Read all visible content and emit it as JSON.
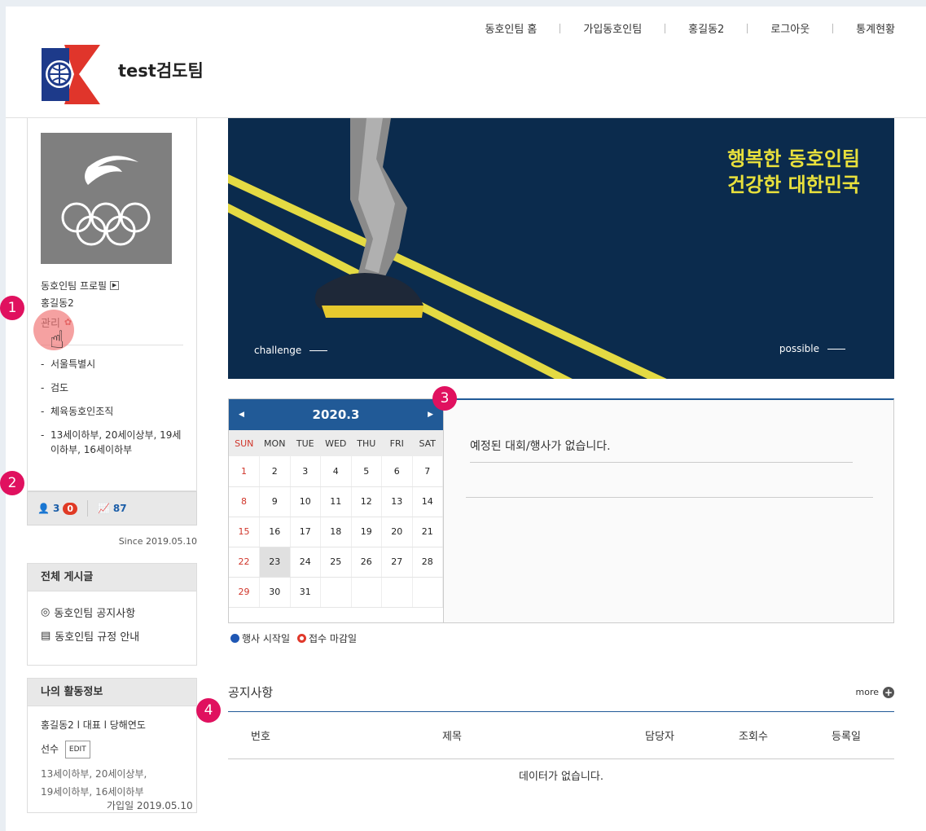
{
  "header": {
    "team_name": "test검도팀",
    "nav": [
      "동호인팀 홈",
      "가입동호인팀",
      "홍길동2",
      "로그아웃",
      "통계현황"
    ]
  },
  "sidebar": {
    "profile_link": "동호인팀 프로필",
    "user": "홍길동2",
    "manage": "관리",
    "info": [
      "서울특별시",
      "검도",
      "체육동호인조직",
      "13세이하부, 20세이상부, 19세이하부, 16세이하부"
    ],
    "members": "3",
    "pending": "0",
    "visits": "87",
    "since": "Since 2019.05.10",
    "board": {
      "title": "전체 게시글",
      "items": [
        "동호인팀 공지사항",
        "동호인팀 규정 안내"
      ]
    },
    "activity": {
      "title": "나의 활동정보",
      "line1": "홍길동2 l 대표 l 당해연도",
      "role": "선수",
      "edit": "EDIT",
      "divisions1": "13세이하부, 20세이상부,",
      "divisions2": "19세이하부, 16세이하부",
      "joined": "가입일 2019.05.10"
    }
  },
  "banner": {
    "line1": "행복한 동호인팀",
    "line2": "건강한 대한민국",
    "left_caption": "challenge",
    "right_caption": "possible"
  },
  "calendar": {
    "month": "2020.3",
    "weekdays": [
      "SUN",
      "MON",
      "TUE",
      "WED",
      "THU",
      "FRI",
      "SAT"
    ],
    "weeks": [
      [
        "1",
        "2",
        "3",
        "4",
        "5",
        "6",
        "7"
      ],
      [
        "8",
        "9",
        "10",
        "11",
        "12",
        "13",
        "14"
      ],
      [
        "15",
        "16",
        "17",
        "18",
        "19",
        "20",
        "21"
      ],
      [
        "22",
        "23",
        "24",
        "25",
        "26",
        "27",
        "28"
      ],
      [
        "29",
        "30",
        "31",
        "",
        "",
        "",
        ""
      ]
    ],
    "today": "23"
  },
  "events": {
    "empty": "예정된 대회/행사가 없습니다."
  },
  "legend": {
    "start": "행사 시작일",
    "deadline": "접수 마감일"
  },
  "notice": {
    "title": "공지사항",
    "more": "more",
    "columns": [
      "번호",
      "제목",
      "담당자",
      "조회수",
      "등록일"
    ],
    "empty": "데이터가 없습니다."
  },
  "markers": [
    "1",
    "2",
    "3",
    "4"
  ],
  "colors": {
    "primary": "#215a97",
    "banner_bg": "#0b2b4d",
    "banner_text": "#e8e03c",
    "sunday": "#d0352a",
    "marker": "#e0115f"
  }
}
